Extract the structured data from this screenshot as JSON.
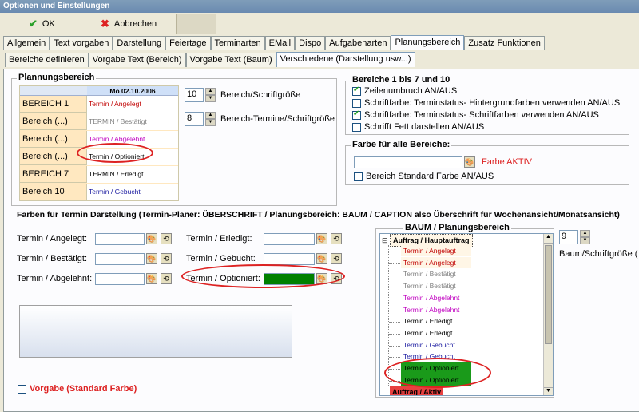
{
  "window": {
    "title": "Optionen und Einstellungen"
  },
  "toolbar": {
    "ok_label": "OK",
    "cancel_label": "Abbrechen"
  },
  "tabs_main": [
    "Allgemein",
    "Text vorgaben",
    "Darstellung",
    "Feiertage",
    "Terminarten",
    "EMail",
    "Dispo",
    "Aufgabenarten",
    "Planungsbereich",
    "Zusatz Funktionen"
  ],
  "tabs_main_active": 8,
  "tabs_sub": [
    "Bereiche definieren",
    "Vorgabe Text (Bereich)",
    "Vorgabe Text (Baum)",
    "Verschiedene (Darstellung usw...)"
  ],
  "tabs_sub_active": 3,
  "planungsbereich": {
    "title": "Plannungsbereich",
    "date_header": "Mo 02.10.2006",
    "rows": [
      {
        "name": "BEREICH 1",
        "value": "Termin / Angelegt",
        "color": "#c00000"
      },
      {
        "name": "Bereich (...)",
        "value": "TERMIN / Bestätigt",
        "color": "#808080"
      },
      {
        "name": "Bereich (...)",
        "value": "Termin / Abgelehnt",
        "color": "#c000c0"
      },
      {
        "name": "Bereich (...)",
        "value": "Termin / Optioniert",
        "color": "#000000"
      },
      {
        "name": "BEREICH 7",
        "value": "TERMIN / Erledigt",
        "color": "#000000"
      },
      {
        "name": "Bereich 10",
        "value": "Termin / Gebucht",
        "color": "#1a1aa0"
      }
    ],
    "spin1": {
      "value": "10",
      "label": "Bereich/Schriftgröße"
    },
    "spin2": {
      "value": "8",
      "label": "Bereich-Termine/Schriftgröße"
    }
  },
  "bereiche17": {
    "title": "Bereiche 1 bis 7 und 10",
    "options": [
      {
        "label": "Zeilenumbruch AN/AUS",
        "checked": true
      },
      {
        "label": "Schriftfarbe: Terminstatus- Hintergrundfarben verwenden AN/AUS",
        "checked": false
      },
      {
        "label": "Schriftfarbe: Terminstatus- Schriftfarben verwenden AN/AUS",
        "checked": true
      },
      {
        "label": "Schrifft Fett darstellen AN/AUS",
        "checked": false
      }
    ]
  },
  "farbe_alle": {
    "title": "Farbe für alle Bereiche:",
    "active_label": "Farbe AKTIV",
    "standard_label": "Bereich Standard Farbe  AN/AUS"
  },
  "farben_termin": {
    "title": "Farben für Termin Darstellung (Termin-Planer: ÜBERSCHRIFT / Planungsbereich: BAUM / CAPTION also Überschrift für Wochenansicht/Monatsansicht)",
    "fields_left": [
      "Termin / Angelegt:",
      "Termin / Bestätigt:",
      "Termin / Abgelehnt:"
    ],
    "fields_right": [
      "Termin / Erledigt:",
      "Termin / Gebucht:",
      "Termin / Optioniert:"
    ],
    "optioniert_color": "#008000",
    "vorgabe_label": "Vorgabe (Standard Farbe)"
  },
  "baum": {
    "title": "BAUM / Planungsbereich",
    "root": "Auftrag / Hauptauftrag",
    "items": [
      {
        "label": "Termin / Angelegt",
        "color": "#c00000",
        "bg": "#fff6e6"
      },
      {
        "label": "Termin / Angelegt",
        "color": "#c00000",
        "bg": "#fff6e6"
      },
      {
        "label": "Termin / Bestätigt",
        "color": "#808080",
        "bg": "#ffffff"
      },
      {
        "label": "Termin / Bestätigt",
        "color": "#808080",
        "bg": "#ffffff"
      },
      {
        "label": "Termin / Abgelehnt",
        "color": "#c000c0",
        "bg": "#ffffff"
      },
      {
        "label": "Termin / Abgelehnt",
        "color": "#c000c0",
        "bg": "#ffffff"
      },
      {
        "label": "Termin / Erledigt",
        "color": "#000000",
        "bg": "#ffffff"
      },
      {
        "label": "Termin / Erledigt",
        "color": "#000000",
        "bg": "#ffffff"
      },
      {
        "label": "Termin / Gebucht",
        "color": "#1a1aa0",
        "bg": "#ffffff"
      },
      {
        "label": "Termin / Gebucht",
        "color": "#1a1aa0",
        "bg": "#ffffff"
      },
      {
        "label": "Termin / Optioniert",
        "color": "#000000",
        "bg": "#1a9a1a"
      },
      {
        "label": "Termin / Optioniert",
        "color": "#000000",
        "bg": "#1a9a1a"
      }
    ],
    "last": "Auftrag / Aktiv",
    "spin": {
      "value": "9",
      "label": "Baum/Schriftgröße ("
    }
  }
}
